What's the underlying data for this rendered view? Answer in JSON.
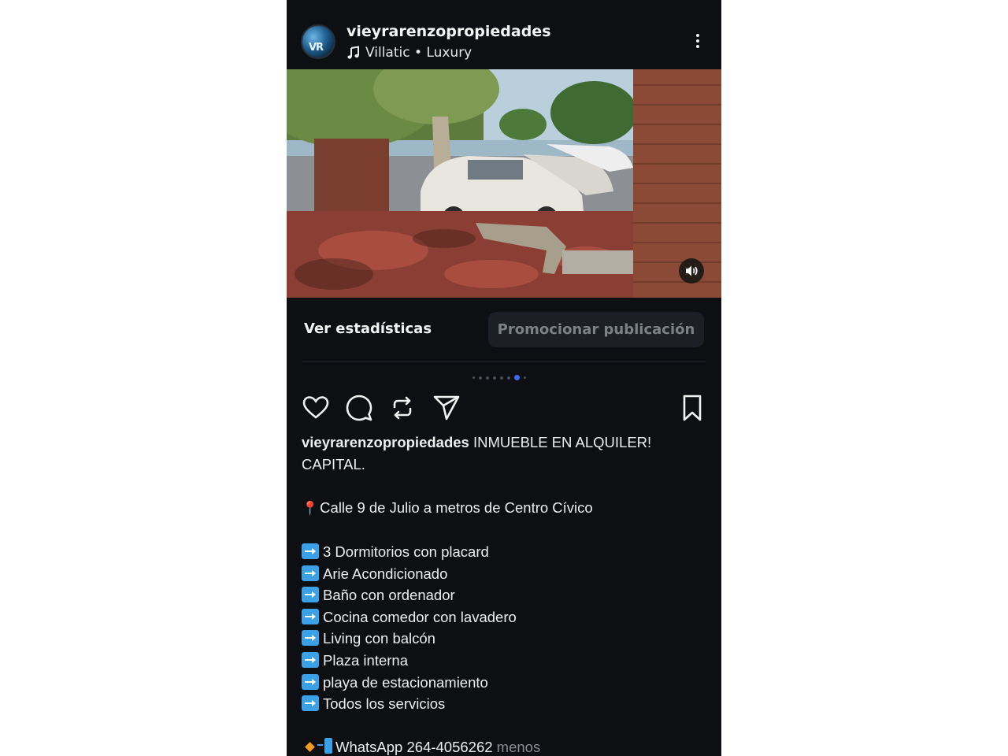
{
  "post": {
    "username": "vieyrarenzopropiedades",
    "avatar_text": "VR",
    "audio_label": "Villatic • Luxury"
  },
  "photo": {
    "description_icon": "mute-icon"
  },
  "insights": {
    "stats_label": "Ver estadísticas",
    "promote_label": "Promocionar publicación"
  },
  "carousel": {
    "total": 8,
    "active_index": 6
  },
  "actions": {
    "like": "heart-icon",
    "comment": "comment-icon",
    "repost": "repost-icon",
    "share": "send-icon",
    "save": "bookmark-icon"
  },
  "caption": {
    "username": "vieyrarenzopropiedades",
    "headline_part1": " INMUEBLE EN ALQUILER!",
    "headline_part2": "CAPITAL.",
    "location": "Calle 9 de Julio a metros de Centro Cívico",
    "features": [
      "3 Dormitorios con placard",
      "Arie Acondicionado",
      "Baño con ordenador",
      "Cocina comedor con lavadero",
      "Living con balcón",
      "Plaza interna",
      "playa de estacionamiento",
      "Todos los servicios"
    ],
    "contact": "WhatsApp 264-4056262",
    "less_label": " menos"
  },
  "colors": {
    "background": "#0d0f13",
    "accent_dot": "#3b6cf0",
    "promote_bg": "#1c1f25",
    "feature_arrow": "#3aa0e8"
  }
}
